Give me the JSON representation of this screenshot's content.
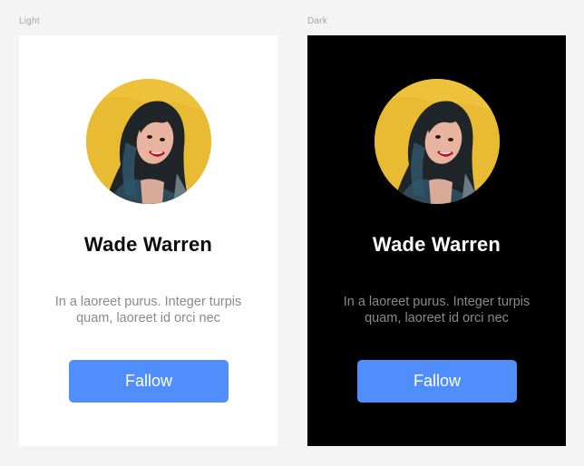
{
  "variants": {
    "light": {
      "label": "Light",
      "name": "Wade Warren",
      "bio_line1": "In a laoreet purus. Integer turpis",
      "bio_line2": "quam, laoreet id orci nec",
      "button": "Fallow"
    },
    "dark": {
      "label": "Dark",
      "name": "Wade Warren",
      "bio_line1": "In a laoreet purus. Integer turpis",
      "bio_line2": "quam, laoreet id orci nec",
      "button": "Fallow"
    }
  },
  "colors": {
    "light_background": "#ffffff",
    "dark_background": "#000000",
    "button": "#4f8efb",
    "bio_text": "#8a8a8a",
    "avatar_backdrop": "#e8b92f"
  },
  "icons": [
    "profile-photo"
  ]
}
